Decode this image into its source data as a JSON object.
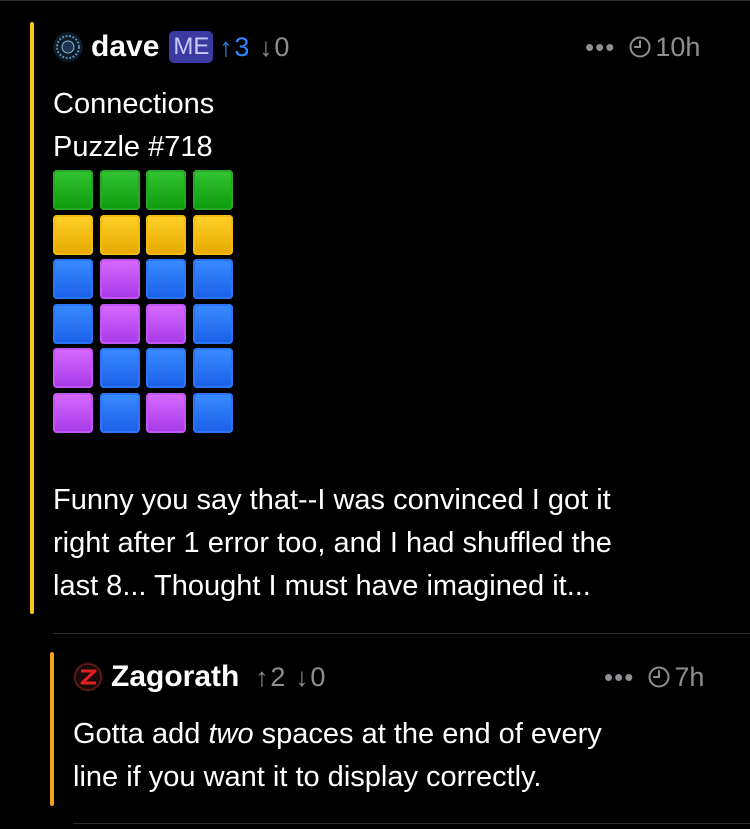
{
  "comment1": {
    "username": "dave",
    "badge": "ME",
    "upvotes": "3",
    "downvotes": "0",
    "more": "•••",
    "time": "10h",
    "title_line1": "Connections",
    "title_line2": "Puzzle #718",
    "grid": [
      [
        "green",
        "green",
        "green",
        "green"
      ],
      [
        "yellow",
        "yellow",
        "yellow",
        "yellow"
      ],
      [
        "blue",
        "purple",
        "blue",
        "blue"
      ],
      [
        "blue",
        "purple",
        "purple",
        "blue"
      ],
      [
        "purple",
        "blue",
        "blue",
        "blue"
      ],
      [
        "purple",
        "blue",
        "purple",
        "blue"
      ]
    ],
    "body_lines": [
      "Funny you say that--I was convinced I got it",
      "right after 1 error too, and I had shuffled the",
      "last 8... Thought I must have imagined it..."
    ],
    "bar_color": "#f5c518"
  },
  "comment2": {
    "username": "Zagorath",
    "upvotes": "2",
    "downvotes": "0",
    "more": "•••",
    "time": "7h",
    "body_pre": "Gotta add ",
    "body_em": "two",
    "body_post": " spaces at the end of every",
    "body_line2": "line if you want it to display correctly.",
    "bar_color": "#f0a21a"
  },
  "colors": {
    "upvote_active": "#2d88ff",
    "muted": "#8e8e93",
    "badge_bg": "#3a3aa0"
  }
}
